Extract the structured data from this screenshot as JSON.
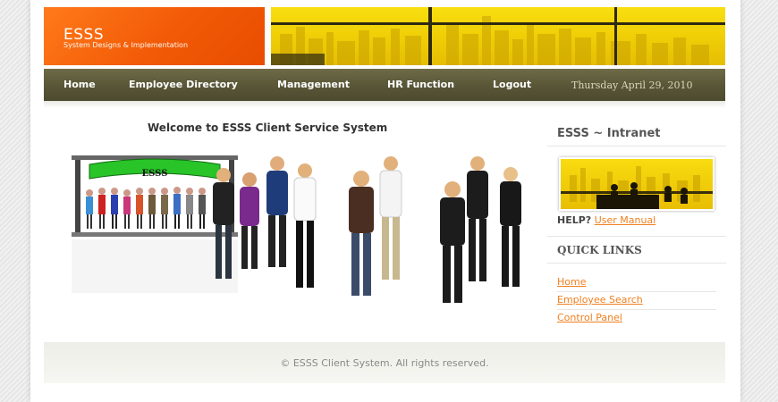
{
  "brand": {
    "name": "ESSS",
    "tagline": "System Designs & Implementation"
  },
  "nav": {
    "items": [
      {
        "label": "Home"
      },
      {
        "label": "Employee Directory"
      },
      {
        "label": "Management"
      },
      {
        "label": "HR Function"
      },
      {
        "label": "Logout"
      }
    ],
    "date": "Thursday April 29, 2010"
  },
  "main": {
    "welcome": "Welcome to ESSS Client Service System",
    "sign_text": "ESSS"
  },
  "sidebar": {
    "title": "ESSS ~ Intranet",
    "help_label": "HELP?",
    "help_link": "User Manual",
    "quick_links_title": "QUICK LINKS",
    "quick_links": [
      {
        "label": "Home"
      },
      {
        "label": "Employee Search"
      },
      {
        "label": "Control Panel"
      }
    ]
  },
  "footer": {
    "text": "© ESSS Client System. All rights reserved."
  },
  "colors": {
    "brand_orange": "#f25a06",
    "nav_olive": "#5a5738",
    "link_orange": "#f08020",
    "banner_yellow": "#f2d208"
  }
}
